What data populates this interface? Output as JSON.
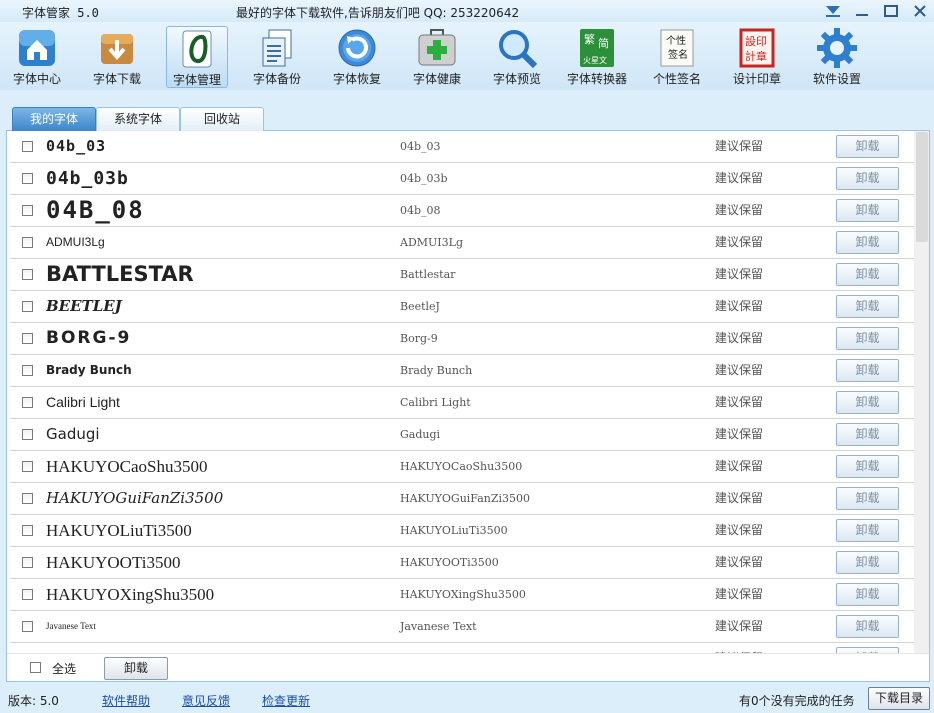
{
  "window": {
    "app_title": "字体管家 5.0",
    "slogan": "最好的字体下载软件,告诉朋友们吧 QQ: 253220642"
  },
  "toolbar": [
    {
      "label": "字体中心",
      "icon": "home-icon"
    },
    {
      "label": "字体下载",
      "icon": "download-box-icon"
    },
    {
      "label": "字体管理",
      "icon": "font-manage-icon",
      "active": true
    },
    {
      "label": "字体备份",
      "icon": "backup-document-icon"
    },
    {
      "label": "字体恢复",
      "icon": "restore-arrow-icon"
    },
    {
      "label": "字体健康",
      "icon": "first-aid-kit-icon"
    },
    {
      "label": "字体预览",
      "icon": "magnifier-icon"
    },
    {
      "label": "字体转换器",
      "icon": "converter-icon"
    },
    {
      "label": "个性签名",
      "icon": "signature-icon"
    },
    {
      "label": "设计印章",
      "icon": "seal-stamp-icon"
    },
    {
      "label": "软件设置",
      "icon": "gear-icon"
    }
  ],
  "converter_icon_text": [
    "繁",
    "简",
    "火星文"
  ],
  "signature_icon_text": [
    "个性",
    "签名"
  ],
  "seal_icon_text": [
    "設印",
    "計章"
  ],
  "tabs": [
    {
      "label": "我的字体",
      "active": true
    },
    {
      "label": "系统字体"
    },
    {
      "label": "回收站"
    }
  ],
  "fonts": [
    {
      "preview": "04b_03",
      "name": "04b_03",
      "status": "建议保留",
      "action": "卸载"
    },
    {
      "preview": "04b_03b",
      "name": "04b_03b",
      "status": "建议保留",
      "action": "卸载"
    },
    {
      "preview": "04B_08",
      "name": "04b_08",
      "status": "建议保留",
      "action": "卸载"
    },
    {
      "preview": "ADMUI3Lg",
      "name": "ADMUI3Lg",
      "status": "建议保留",
      "action": "卸载"
    },
    {
      "preview": "BATTLESTAR",
      "name": "Battlestar",
      "status": "建议保留",
      "action": "卸载"
    },
    {
      "preview": "BEETLEJ",
      "name": "BeetleJ",
      "status": "建议保留",
      "action": "卸载"
    },
    {
      "preview": "BORG-9",
      "name": "Borg-9",
      "status": "建议保留",
      "action": "卸载"
    },
    {
      "preview": "Brady Bunch",
      "name": "Brady Bunch",
      "status": "建议保留",
      "action": "卸载"
    },
    {
      "preview": "Calibri Light",
      "name": "Calibri Light",
      "status": "建议保留",
      "action": "卸载"
    },
    {
      "preview": "Gadugi",
      "name": "Gadugi",
      "status": "建议保留",
      "action": "卸载"
    },
    {
      "preview": "HAKUYOCaoShu3500",
      "name": "HAKUYOCaoShu3500",
      "status": "建议保留",
      "action": "卸载"
    },
    {
      "preview": "HAKUYOGuiFanZi3500",
      "name": "HAKUYOGuiFanZi3500",
      "status": "建议保留",
      "action": "卸载"
    },
    {
      "preview": "HAKUYOLiuTi3500",
      "name": "HAKUYOLiuTi3500",
      "status": "建议保留",
      "action": "卸载"
    },
    {
      "preview": "HAKUYOOTi3500",
      "name": "HAKUYOOTi3500",
      "status": "建议保留",
      "action": "卸载"
    },
    {
      "preview": "HAKUYOXingShu3500",
      "name": "HAKUYOXingShu3500",
      "status": "建议保留",
      "action": "卸载"
    },
    {
      "preview": "Javanese Text",
      "name": "Javanese Text",
      "status": "建议保留",
      "action": "卸载"
    },
    {
      "preview": "",
      "name": "",
      "status": "建议保留",
      "action": "卸载"
    }
  ],
  "bulk": {
    "select_all_label": "全选",
    "uninstall_label": "卸载"
  },
  "status": {
    "version": "版本: 5.0",
    "links": [
      "软件帮助",
      "意见反馈",
      "检查更新"
    ],
    "task_text": "有0个没有完成的任务",
    "download_dir_label": "下载目录"
  }
}
